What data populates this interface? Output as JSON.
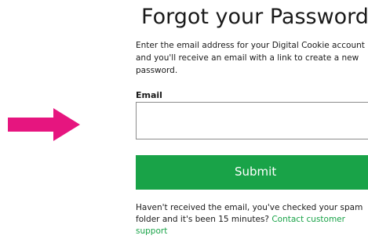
{
  "page": {
    "title": "Forgot your Password?",
    "description": "Enter the email address for your Digital Cookie account and you'll receive an email with a link to create a new password."
  },
  "form": {
    "email_label": "Email",
    "email_value": "",
    "submit_label": "Submit"
  },
  "help": {
    "text": "Haven't received the email, you've checked your spam folder and it's been 15 minutes? ",
    "link_label": "Contact customer support"
  },
  "annotation": {
    "arrow_icon": "right-arrow-icon",
    "arrow_color": "#e6157f"
  },
  "colors": {
    "accent": "#19a348",
    "text": "#1a1a1a",
    "input_border": "#8c8c8c"
  }
}
